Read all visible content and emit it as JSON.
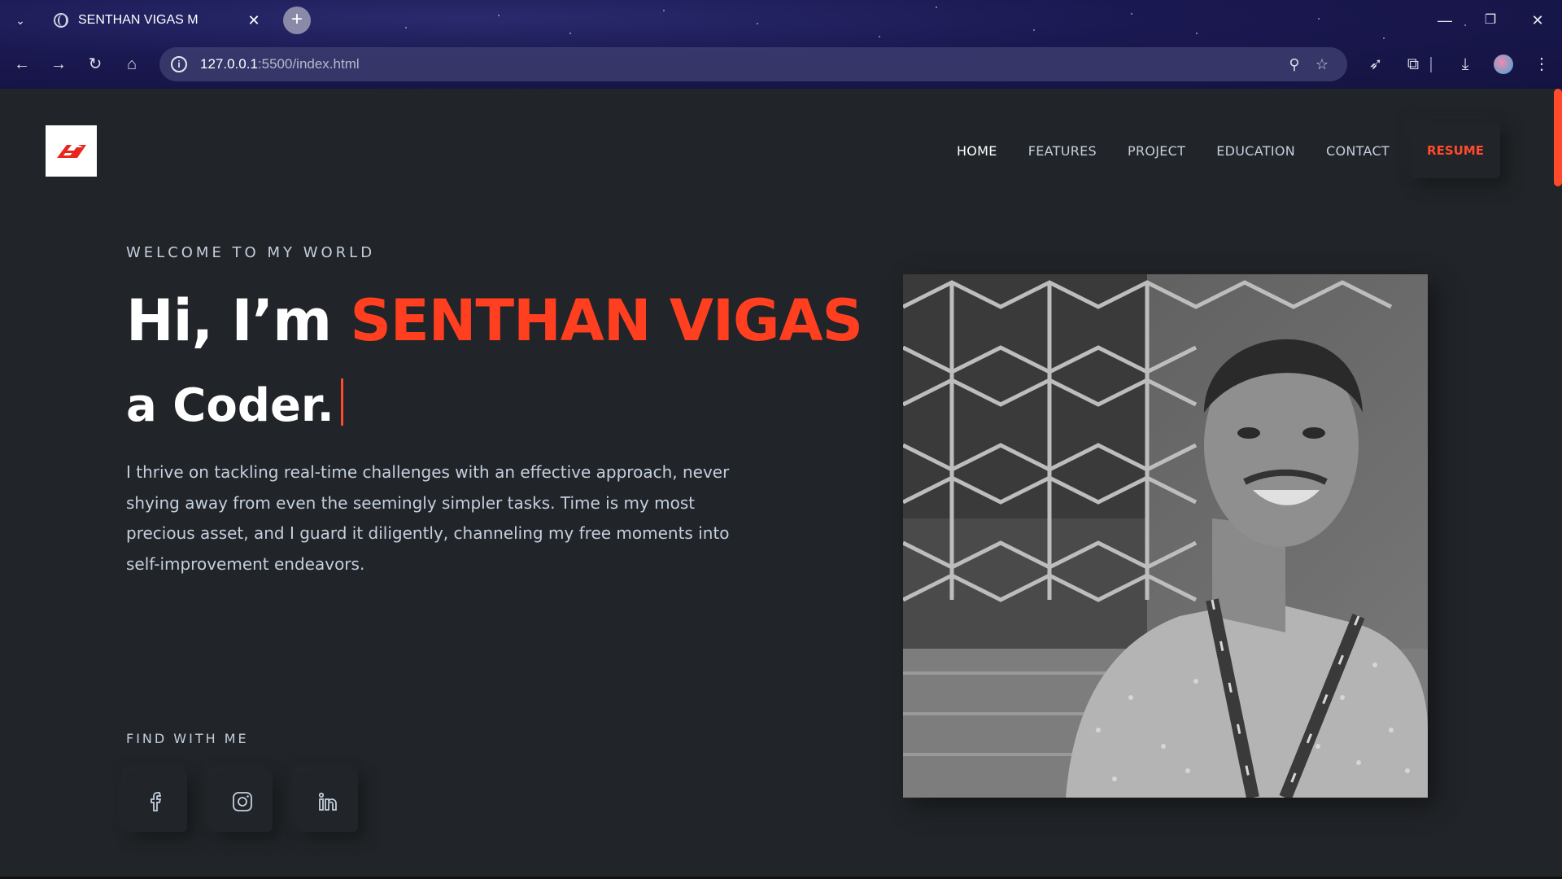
{
  "browser": {
    "tab_title": "SENTHAN VIGAS M",
    "url_host": "127.0.0.1",
    "url_rest": ":5500/index.html"
  },
  "nav": {
    "items": [
      "HOME",
      "FEATURES",
      "PROJECT",
      "EDUCATION",
      "CONTACT"
    ],
    "active": "HOME",
    "resume_label": "RESUME"
  },
  "hero": {
    "welcome": "WELCOME TO MY WORLD",
    "greeting": "Hi, I’m ",
    "name": "SENTHAN VIGAS",
    "role_line": "a Coder.",
    "description": "I thrive on tackling real-time challenges with an effective approach, never shying away from even the seemingly simpler tasks. Time is my most precious asset, and I guard it diligently, channeling my free moments into self-improvement endeavors."
  },
  "social": {
    "heading": "FIND WITH ME",
    "icons": [
      "facebook-icon",
      "instagram-icon",
      "linkedin-icon"
    ]
  },
  "colors": {
    "accent": "#ff4b2b",
    "background": "#212428",
    "text": "#c4cfde"
  }
}
